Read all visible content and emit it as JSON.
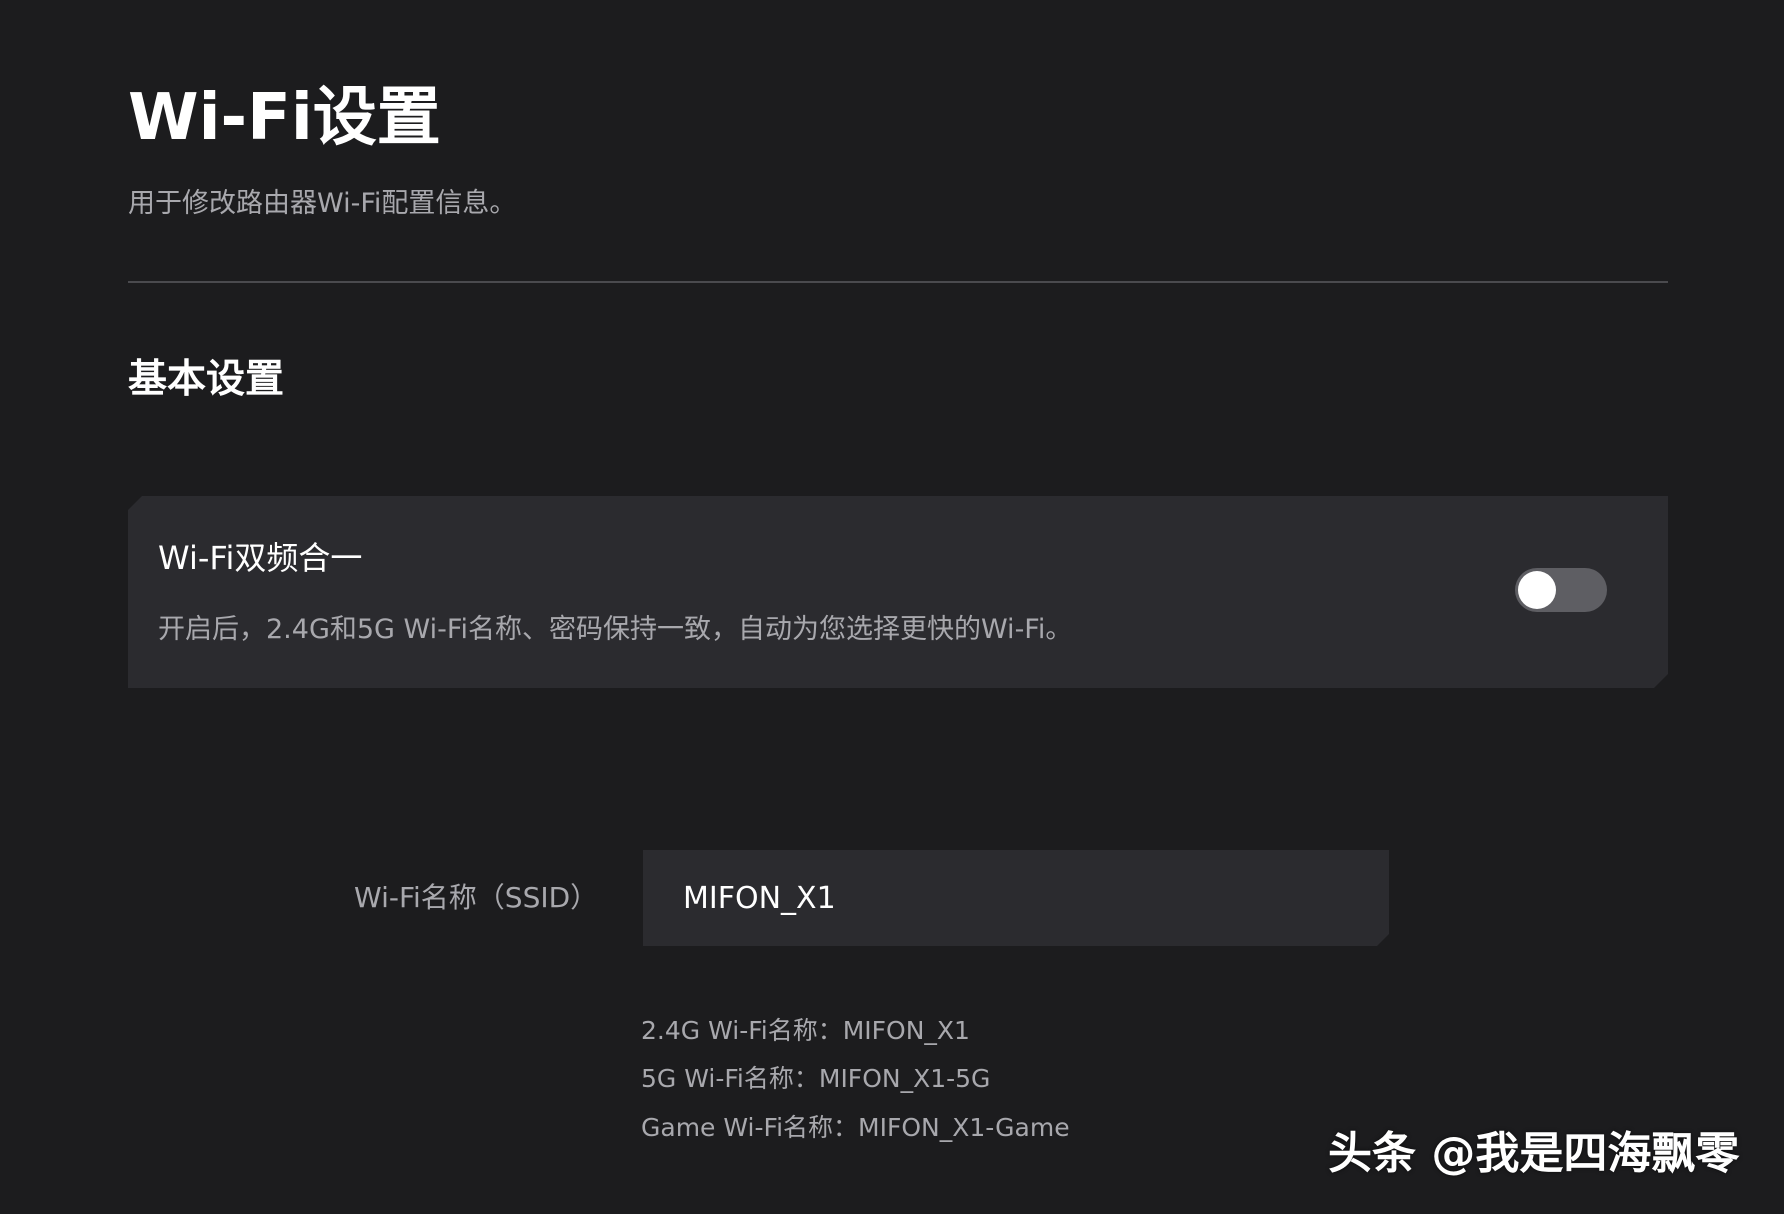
{
  "header": {
    "title": "Wi-Fi设置",
    "subtitle": "用于修改路由器Wi-Fi配置信息。"
  },
  "basic_settings": {
    "section_title": "基本设置",
    "dual_band": {
      "title": "Wi-Fi双频合一",
      "description": "开启后，2.4G和5G Wi-Fi名称、密码保持一致，自动为您选择更快的Wi-Fi。",
      "enabled": false
    },
    "ssid": {
      "label": "Wi-Fi名称（SSID）",
      "value": "MIFON_X1"
    },
    "hints": [
      "2.4G Wi-Fi名称：MIFON_X1",
      "5G Wi-Fi名称：MIFON_X1-5G",
      "Game Wi-Fi名称：MIFON_X1-Game"
    ]
  },
  "watermark": "头条 @我是四海飘零",
  "colors": {
    "background": "#1c1c1e",
    "card": "#2b2b2f",
    "toggle_off": "#5e5e63",
    "secondary_text": "#a8a8ad"
  }
}
